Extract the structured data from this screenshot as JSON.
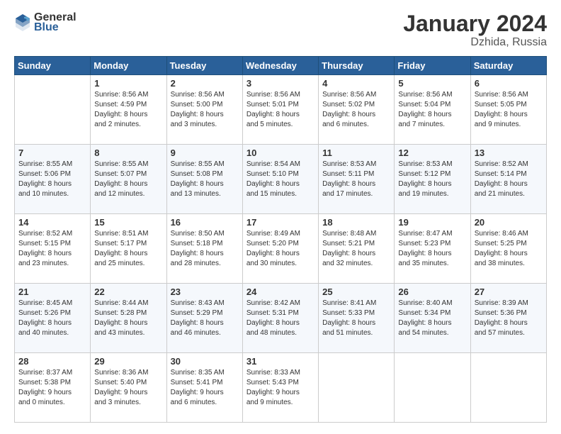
{
  "header": {
    "logo_general": "General",
    "logo_blue": "Blue",
    "title": "January 2024",
    "subtitle": "Dzhida, Russia"
  },
  "weekdays": [
    "Sunday",
    "Monday",
    "Tuesday",
    "Wednesday",
    "Thursday",
    "Friday",
    "Saturday"
  ],
  "weeks": [
    [
      {
        "day": "",
        "info": ""
      },
      {
        "day": "1",
        "info": "Sunrise: 8:56 AM\nSunset: 4:59 PM\nDaylight: 8 hours\nand 2 minutes."
      },
      {
        "day": "2",
        "info": "Sunrise: 8:56 AM\nSunset: 5:00 PM\nDaylight: 8 hours\nand 3 minutes."
      },
      {
        "day": "3",
        "info": "Sunrise: 8:56 AM\nSunset: 5:01 PM\nDaylight: 8 hours\nand 5 minutes."
      },
      {
        "day": "4",
        "info": "Sunrise: 8:56 AM\nSunset: 5:02 PM\nDaylight: 8 hours\nand 6 minutes."
      },
      {
        "day": "5",
        "info": "Sunrise: 8:56 AM\nSunset: 5:04 PM\nDaylight: 8 hours\nand 7 minutes."
      },
      {
        "day": "6",
        "info": "Sunrise: 8:56 AM\nSunset: 5:05 PM\nDaylight: 8 hours\nand 9 minutes."
      }
    ],
    [
      {
        "day": "7",
        "info": "Sunrise: 8:55 AM\nSunset: 5:06 PM\nDaylight: 8 hours\nand 10 minutes."
      },
      {
        "day": "8",
        "info": "Sunrise: 8:55 AM\nSunset: 5:07 PM\nDaylight: 8 hours\nand 12 minutes."
      },
      {
        "day": "9",
        "info": "Sunrise: 8:55 AM\nSunset: 5:08 PM\nDaylight: 8 hours\nand 13 minutes."
      },
      {
        "day": "10",
        "info": "Sunrise: 8:54 AM\nSunset: 5:10 PM\nDaylight: 8 hours\nand 15 minutes."
      },
      {
        "day": "11",
        "info": "Sunrise: 8:53 AM\nSunset: 5:11 PM\nDaylight: 8 hours\nand 17 minutes."
      },
      {
        "day": "12",
        "info": "Sunrise: 8:53 AM\nSunset: 5:12 PM\nDaylight: 8 hours\nand 19 minutes."
      },
      {
        "day": "13",
        "info": "Sunrise: 8:52 AM\nSunset: 5:14 PM\nDaylight: 8 hours\nand 21 minutes."
      }
    ],
    [
      {
        "day": "14",
        "info": "Sunrise: 8:52 AM\nSunset: 5:15 PM\nDaylight: 8 hours\nand 23 minutes."
      },
      {
        "day": "15",
        "info": "Sunrise: 8:51 AM\nSunset: 5:17 PM\nDaylight: 8 hours\nand 25 minutes."
      },
      {
        "day": "16",
        "info": "Sunrise: 8:50 AM\nSunset: 5:18 PM\nDaylight: 8 hours\nand 28 minutes."
      },
      {
        "day": "17",
        "info": "Sunrise: 8:49 AM\nSunset: 5:20 PM\nDaylight: 8 hours\nand 30 minutes."
      },
      {
        "day": "18",
        "info": "Sunrise: 8:48 AM\nSunset: 5:21 PM\nDaylight: 8 hours\nand 32 minutes."
      },
      {
        "day": "19",
        "info": "Sunrise: 8:47 AM\nSunset: 5:23 PM\nDaylight: 8 hours\nand 35 minutes."
      },
      {
        "day": "20",
        "info": "Sunrise: 8:46 AM\nSunset: 5:25 PM\nDaylight: 8 hours\nand 38 minutes."
      }
    ],
    [
      {
        "day": "21",
        "info": "Sunrise: 8:45 AM\nSunset: 5:26 PM\nDaylight: 8 hours\nand 40 minutes."
      },
      {
        "day": "22",
        "info": "Sunrise: 8:44 AM\nSunset: 5:28 PM\nDaylight: 8 hours\nand 43 minutes."
      },
      {
        "day": "23",
        "info": "Sunrise: 8:43 AM\nSunset: 5:29 PM\nDaylight: 8 hours\nand 46 minutes."
      },
      {
        "day": "24",
        "info": "Sunrise: 8:42 AM\nSunset: 5:31 PM\nDaylight: 8 hours\nand 48 minutes."
      },
      {
        "day": "25",
        "info": "Sunrise: 8:41 AM\nSunset: 5:33 PM\nDaylight: 8 hours\nand 51 minutes."
      },
      {
        "day": "26",
        "info": "Sunrise: 8:40 AM\nSunset: 5:34 PM\nDaylight: 8 hours\nand 54 minutes."
      },
      {
        "day": "27",
        "info": "Sunrise: 8:39 AM\nSunset: 5:36 PM\nDaylight: 8 hours\nand 57 minutes."
      }
    ],
    [
      {
        "day": "28",
        "info": "Sunrise: 8:37 AM\nSunset: 5:38 PM\nDaylight: 9 hours\nand 0 minutes."
      },
      {
        "day": "29",
        "info": "Sunrise: 8:36 AM\nSunset: 5:40 PM\nDaylight: 9 hours\nand 3 minutes."
      },
      {
        "day": "30",
        "info": "Sunrise: 8:35 AM\nSunset: 5:41 PM\nDaylight: 9 hours\nand 6 minutes."
      },
      {
        "day": "31",
        "info": "Sunrise: 8:33 AM\nSunset: 5:43 PM\nDaylight: 9 hours\nand 9 minutes."
      },
      {
        "day": "",
        "info": ""
      },
      {
        "day": "",
        "info": ""
      },
      {
        "day": "",
        "info": ""
      }
    ]
  ]
}
